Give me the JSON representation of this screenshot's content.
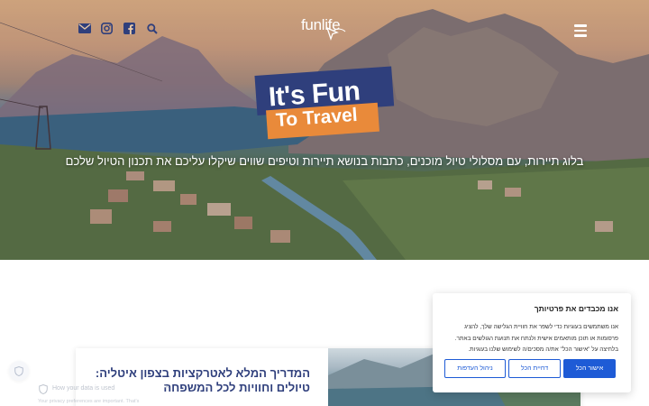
{
  "header": {
    "logo_text": "funlife",
    "icons": [
      "email-icon",
      "instagram-icon",
      "facebook-icon",
      "search-icon"
    ],
    "menu_icon": "hamburger-menu-icon"
  },
  "hero": {
    "badge_line1": "It's Fun",
    "badge_line2": "To Travel",
    "tagline": "בלוג תיירות, עם מסלולי טיול מוכנים, כתבות בנושא תיירות וטיפים שווים שיקלו עליכם את תכנון הטיול שלכם"
  },
  "article": {
    "title": "המדריך המלא לאטרקציות בצפון איטליה: טיולים וחוויות לכל המשפחה"
  },
  "cookie_banner": {
    "title": "אנו מכבדים את פרטיותך",
    "body_line1": "אנו משתמשים בעוגיות כדי לשפר את חוויית הגלישה שלך, להציג",
    "body_line2": "פרסומות או תוכן מותאמים אישית ולנתח את תנועת הגולשים באתר.",
    "body_line3": "בלחיצה על \"אישור הכל\" את/ה מסכים/ה לשימוש שלנו בעוגיות.",
    "manage_label": "ניהול העדפות",
    "reject_label": "דחיית הכל",
    "accept_label": "אישור הכל"
  },
  "privacy_widget": {
    "title": "How your data is used",
    "subtitle": "Your privacy preferences are important. That's"
  },
  "colors": {
    "brand_navy": "#2f3f7c",
    "brand_orange": "#e98a3a",
    "accent_blue": "#1e5bd6"
  }
}
